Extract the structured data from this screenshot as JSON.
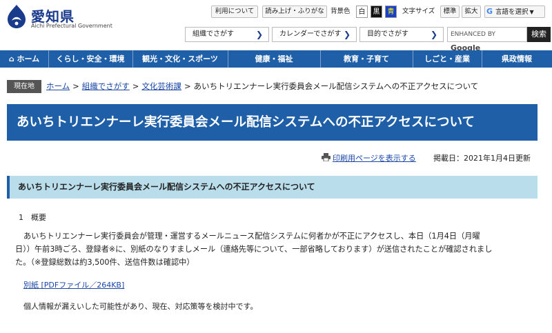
{
  "header": {
    "logo_ja": "愛知県",
    "logo_en": "Aichi Prefectural Government",
    "util": {
      "usage": "利用について",
      "readaloud": "読み上げ・ふりがな",
      "bgcolor_label": "背景色",
      "bg_white": "白",
      "bg_black": "黒",
      "bg_blue": "青",
      "fontsize_label": "文字サイズ",
      "font_standard": "標準",
      "font_large": "拡大",
      "translate": "言語を選択"
    },
    "nav": {
      "org": "組織でさがす",
      "calendar": "カレンダーでさがす",
      "purpose": "目的でさがす"
    },
    "search": {
      "enhanced": "ENHANCED BY",
      "google": "Google",
      "button": "検索"
    }
  },
  "mainnav": [
    {
      "label": "ホーム"
    },
    {
      "label": "くらし・安全・環境"
    },
    {
      "label": "観光・文化・スポーツ"
    },
    {
      "label": "健康・福祉"
    },
    {
      "label": "教育・子育て"
    },
    {
      "label": "しごと・産業"
    },
    {
      "label": "県政情報"
    }
  ],
  "breadcrumb": {
    "here": "現在地",
    "items": [
      "ホーム",
      "組織でさがす",
      "文化芸術課"
    ],
    "sep": ">",
    "current": "あいちトリエンナーレ実行委員会メール配信システムへの不正アクセスについて"
  },
  "title": "あいちトリエンナーレ実行委員会メール配信システムへの不正アクセスについて",
  "print_link": "印刷用ページを表示する",
  "updated": "掲載日：2021年1月4日更新",
  "subhead": "あいちトリエンナーレ実行委員会メール配信システムへの不正アクセスについて",
  "section": "1　概要",
  "body_lines": [
    "あいちトリエンナーレ実行委員会が管理・運営するメールニュース配信システムに何者かが不正にアクセスし、本日（1月4日（月曜",
    "日））午前3時ごろ、登録者※に、別紙のなりすましメール（連絡先等について、一部省略しております）が送信されたことが確認されまし",
    "た。（※登録総数は約3,500件、送信件数は確認中）"
  ],
  "pdf_link": "別紙 [PDFファイル／264KB]",
  "info": "個人情報が漏えいした可能性があり、現在、対応策等を検討中です。",
  "colors": {
    "primary": "#1f5fa8",
    "subhead_bg": "#b9ddea",
    "link": "#1a47a8"
  }
}
